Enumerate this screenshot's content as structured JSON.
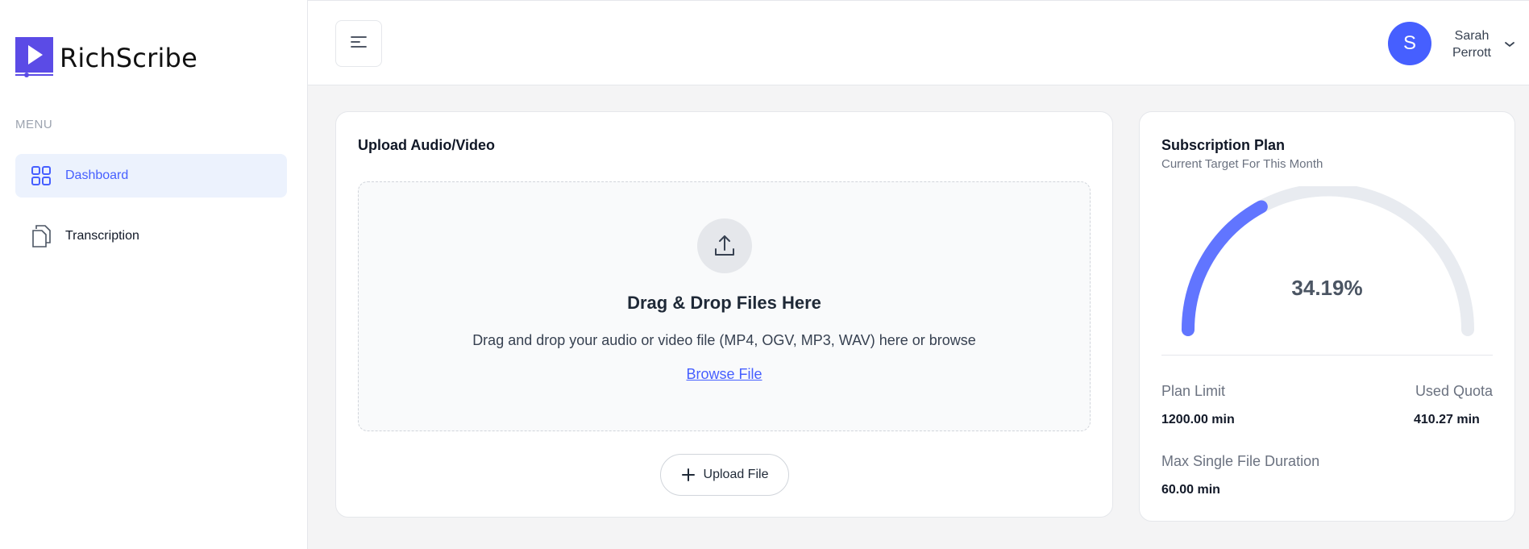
{
  "brand": {
    "name": "RichScribe",
    "accent": "#465fff",
    "logo_color": "#5b4be6"
  },
  "sidebar": {
    "menu_label": "MENU",
    "items": [
      {
        "label": "Dashboard",
        "icon": "grid-icon",
        "active": true
      },
      {
        "label": "Transcription",
        "icon": "documents-icon",
        "active": false
      }
    ]
  },
  "header": {
    "toggle_icon": "menu-lines-icon",
    "user": {
      "initial": "S",
      "name_line1": "Sarah",
      "name_line2": "Perrott"
    }
  },
  "upload": {
    "title": "Upload Audio/Video",
    "drop_title": "Drag & Drop Files Here",
    "drop_desc": "Drag and drop your audio or video file (MP4, OGV, MP3, WAV) here or browse",
    "browse_label": "Browse File",
    "button_label": "Upload File"
  },
  "plan": {
    "title": "Subscription Plan",
    "subtitle": "Current Target For This Month",
    "percent_value": 34.19,
    "percent_label": "34.19%",
    "plan_limit_label": "Plan Limit",
    "plan_limit_value": "1200.00 min",
    "used_quota_label": "Used Quota",
    "used_quota_value": "410.27 min",
    "max_file_label": "Max Single File Duration",
    "max_file_value": "60.00 min"
  }
}
